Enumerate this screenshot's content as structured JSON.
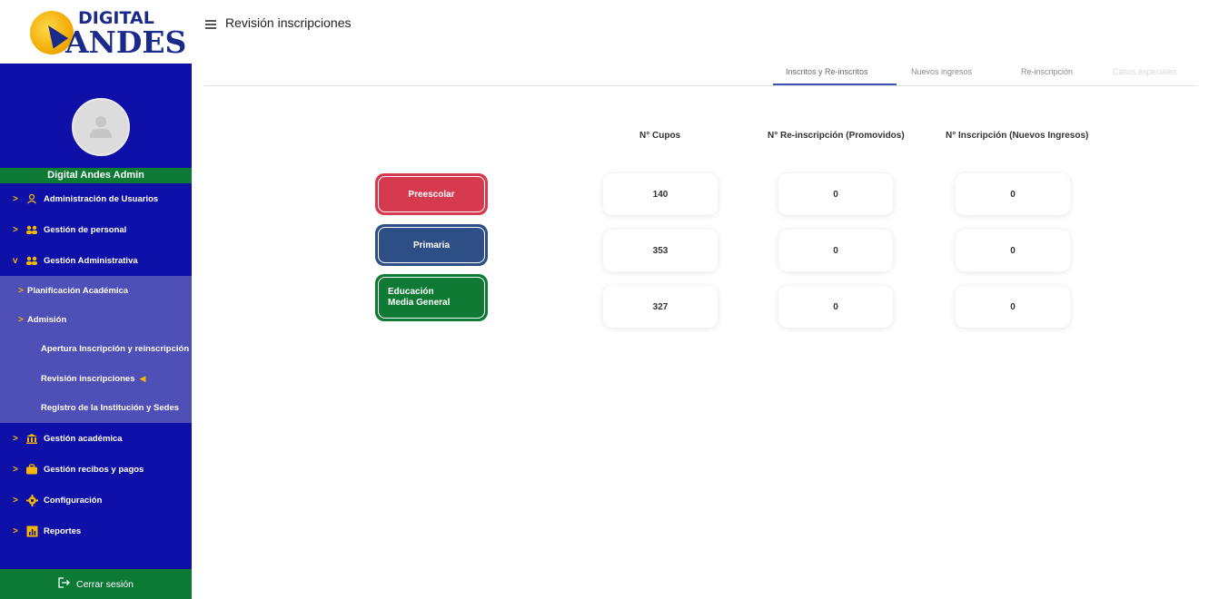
{
  "brand": {
    "line1": "DIGITAL",
    "line2": "ANDES"
  },
  "user": {
    "name": "Digital Andes Admin"
  },
  "sidebar": {
    "items": [
      {
        "label": "Administración de Usuarios",
        "icon": "users-icon",
        "expanded": false
      },
      {
        "label": "Gestión de personal",
        "icon": "staff-icon",
        "expanded": false
      },
      {
        "label": "Gestión Administrativa",
        "icon": "admin-icon",
        "expanded": true
      }
    ],
    "sub_items": [
      {
        "label": "Planificación Académica"
      },
      {
        "label": "Admisión"
      }
    ],
    "sub_sub_items": [
      {
        "label": "Apertura Inscripción y reinscripción"
      },
      {
        "label": "Revisión inscripciones"
      },
      {
        "label": "Registro de la Institución y Sedes"
      }
    ],
    "bottom_items": [
      {
        "label": "Gestión académica",
        "icon": "bank-icon"
      },
      {
        "label": "Gestión recibos y pagos",
        "icon": "briefcase-icon"
      },
      {
        "label": "Configuración",
        "icon": "gear-icon"
      },
      {
        "label": "Reportes",
        "icon": "report-icon"
      }
    ],
    "logout_label": "Cerrar sesión"
  },
  "header": {
    "title": "Revisión inscripciones"
  },
  "tabs": [
    {
      "label": "Inscritos y Re-inscritos",
      "active": true
    },
    {
      "label": "Nuevos ingresos",
      "active": false
    },
    {
      "label": "Re-inscripción",
      "active": false
    },
    {
      "label": "Casos especiales",
      "active": false
    }
  ],
  "table": {
    "headers": [
      "N° Cupos",
      "N° Re-inscripción (Promovidos)",
      "N° Inscripción (Nuevos Ingresos)"
    ],
    "rows": [
      {
        "level": "Preescolar",
        "color": "#d53a4e",
        "cupos": "140",
        "reinscripcion": "0",
        "inscripcion": "0"
      },
      {
        "level": "Primaria",
        "color": "#2e4f85",
        "cupos": "353",
        "reinscripcion": "0",
        "inscripcion": "0"
      },
      {
        "level": "Educación Media General",
        "color": "#0f7a34",
        "cupos": "327",
        "reinscripcion": "0",
        "inscripcion": "0"
      }
    ]
  },
  "colors": {
    "sidebar_bg": "#0f10a8",
    "submenu_bg": "#4f4fb8",
    "green": "#0c7a34",
    "accent_yellow": "#f5b800",
    "tab_accent": "#3f51b5"
  }
}
